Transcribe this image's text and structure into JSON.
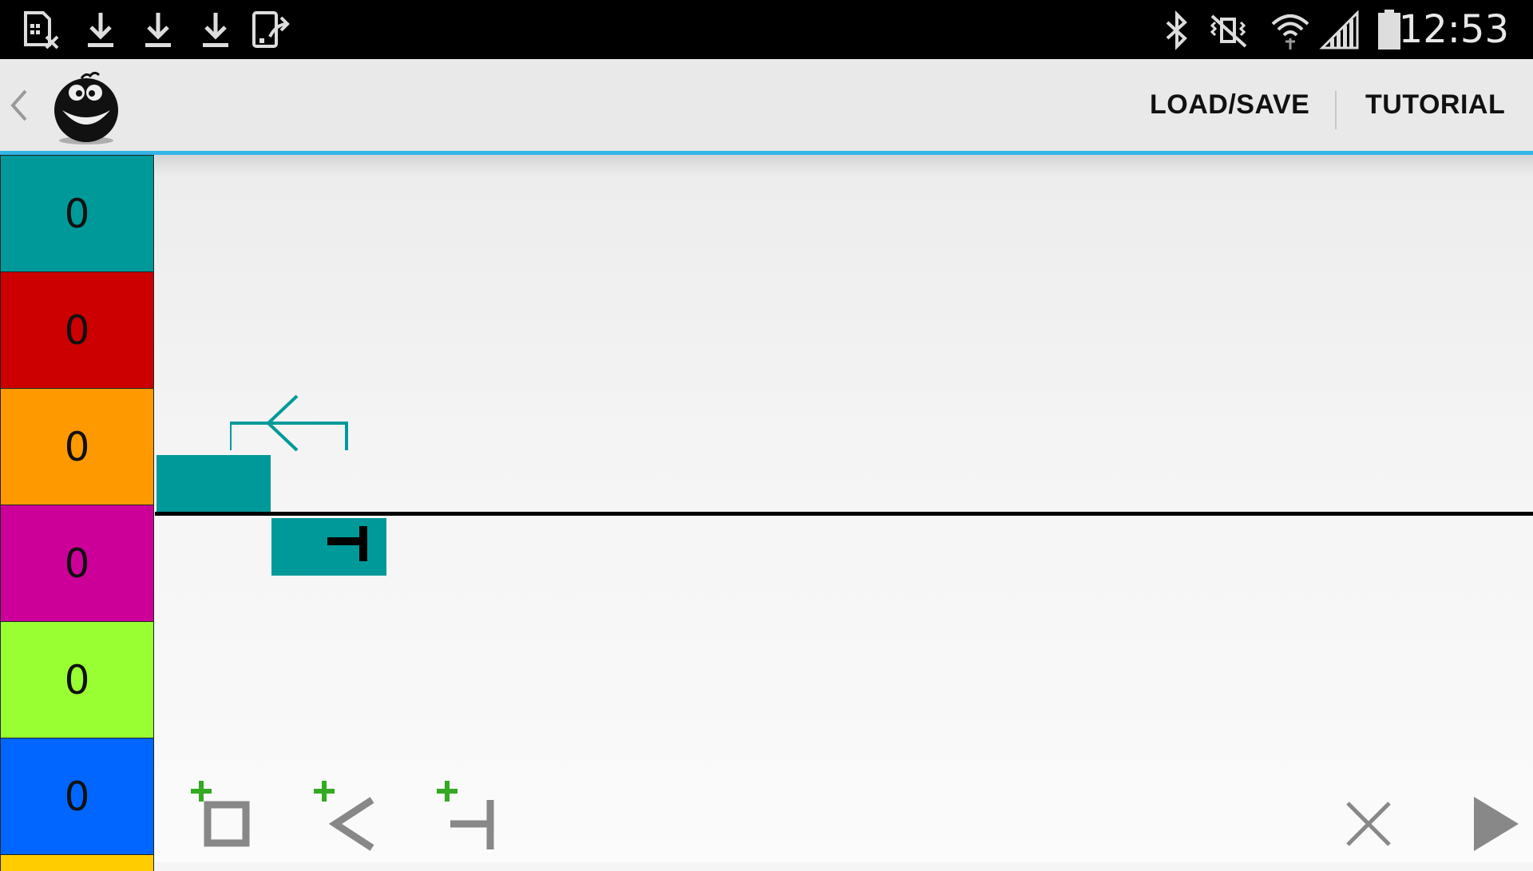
{
  "status_bar": {
    "left_icons": [
      "sd-card-cancel-icon",
      "download-icon",
      "download-icon",
      "download-icon",
      "device-transfer-icon"
    ],
    "right_icons": [
      "bluetooth-icon",
      "vibrate-mute-icon",
      "wifi-icon",
      "signal-icon",
      "battery-icon"
    ],
    "time": "12:53"
  },
  "action_bar": {
    "up_icon": "chevron-left-icon",
    "logo_icon": "smiley-logo-icon",
    "buttons": {
      "load_save": "LOAD/SAVE",
      "tutorial": "TUTORIAL"
    },
    "accent_color": "#33b5e5"
  },
  "registers": [
    {
      "value": "0",
      "color": "#009999"
    },
    {
      "value": "0",
      "color": "#cc0000"
    },
    {
      "value": "0",
      "color": "#ff9900"
    },
    {
      "value": "0",
      "color": "#cc0099"
    },
    {
      "value": "0",
      "color": "#99ff33"
    },
    {
      "value": "0",
      "color": "#0066ff"
    }
  ],
  "canvas": {
    "blocks": [
      {
        "kind": "box",
        "color": "#009999"
      },
      {
        "kind": "loop-arrow",
        "color": "#009999"
      },
      {
        "kind": "end-branch",
        "color": "#009999",
        "icon": "end-branch-icon"
      }
    ]
  },
  "toolbar": {
    "add_box": "add-box-icon",
    "add_loop": "add-loop-icon",
    "add_branch": "add-branch-icon",
    "clear": "close-icon",
    "run": "play-icon",
    "plus_color": "#33aa22"
  }
}
